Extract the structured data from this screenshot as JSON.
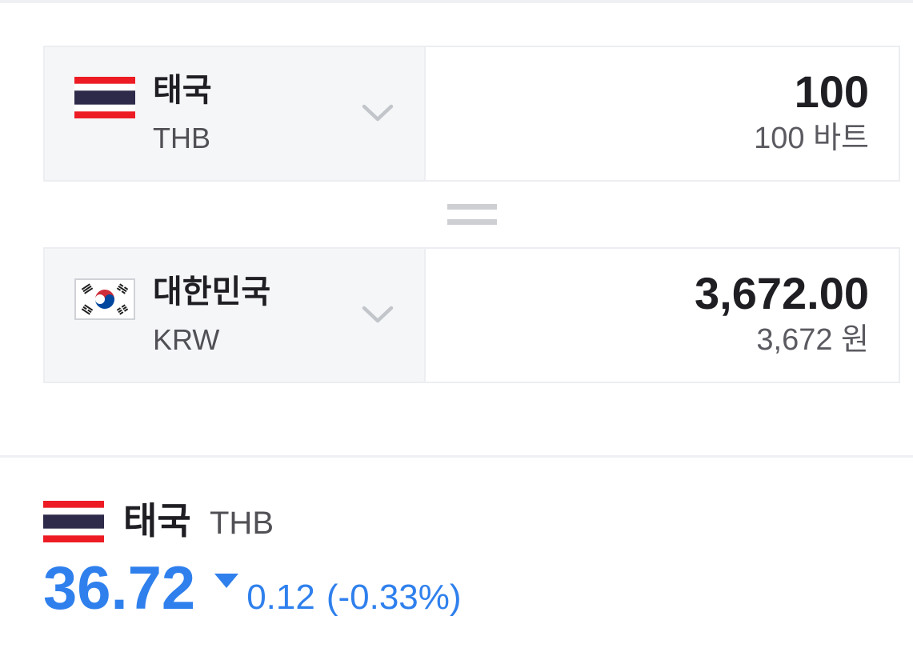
{
  "from": {
    "country": "태국",
    "code": "THB",
    "amount": "100",
    "amount_text": "100 바트",
    "flag": "thailand-flag-icon"
  },
  "to": {
    "country": "대한민국",
    "code": "KRW",
    "amount": "3,672.00",
    "amount_text": "3,672 원",
    "flag": "south-korea-flag-icon"
  },
  "rate": {
    "country": "태국",
    "code": "THB",
    "value": "36.72",
    "change": "0.12",
    "change_percent": "(-0.33%)",
    "direction": "down"
  },
  "colors": {
    "accent": "#2f80ed",
    "panel": "#f5f6f8",
    "border": "#eceef1"
  }
}
